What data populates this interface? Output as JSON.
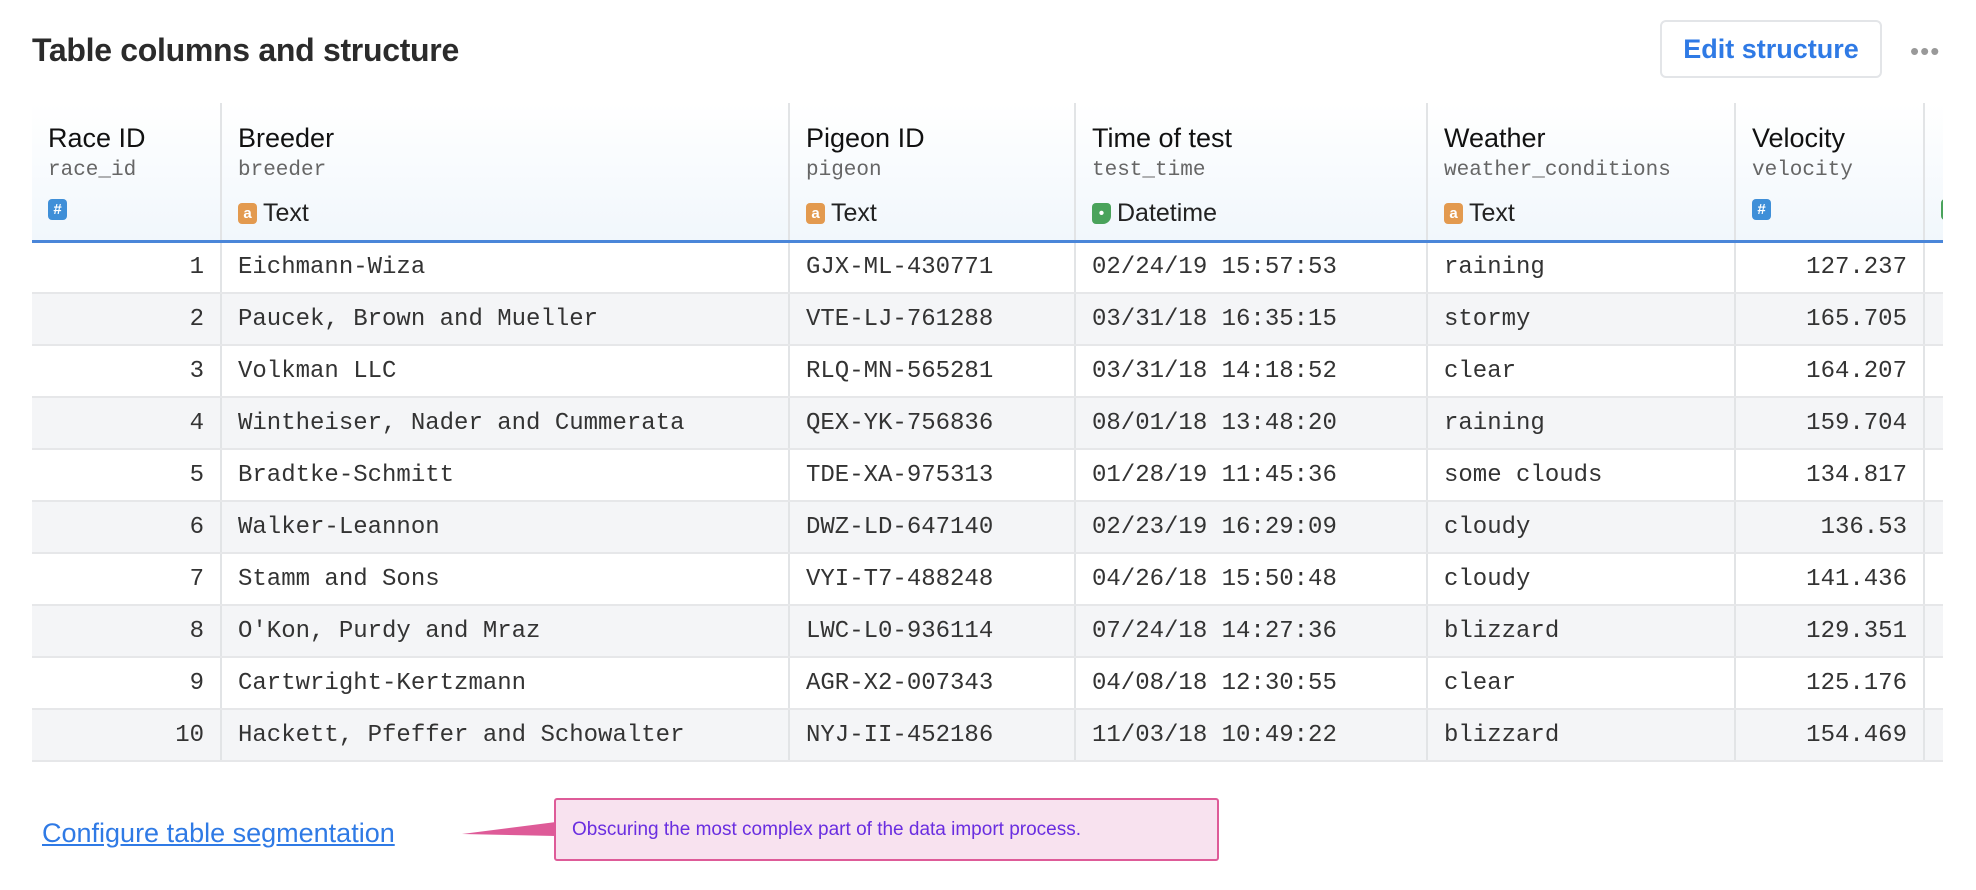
{
  "header": {
    "title": "Table columns and structure",
    "edit_button": "Edit structure",
    "more_icon": "more-horizontal-icon"
  },
  "columns": [
    {
      "name": "Race ID",
      "key": "race_id",
      "type": "",
      "type_icon": "number-icon"
    },
    {
      "name": "Breeder",
      "key": "breeder",
      "type": "Text",
      "type_icon": "text-icon"
    },
    {
      "name": "Pigeon ID",
      "key": "pigeon",
      "type": "Text",
      "type_icon": "text-icon"
    },
    {
      "name": "Time of test",
      "key": "test_time",
      "type": "Datetime",
      "type_icon": "datetime-icon"
    },
    {
      "name": "Weather",
      "key": "weather_conditions",
      "type": "Text",
      "type_icon": "text-icon"
    },
    {
      "name": "Velocity",
      "key": "velocity",
      "type": "",
      "type_icon": "number-icon"
    }
  ],
  "rows": [
    [
      "1",
      "Eichmann-Wiza",
      "GJX-ML-430771",
      "02/24/19 15:57:53",
      "raining",
      "127.237"
    ],
    [
      "2",
      "Paucek, Brown and Mueller",
      "VTE-LJ-761288",
      "03/31/18 16:35:15",
      "stormy",
      "165.705"
    ],
    [
      "3",
      "Volkman LLC",
      "RLQ-MN-565281",
      "03/31/18 14:18:52",
      "clear",
      "164.207"
    ],
    [
      "4",
      "Wintheiser, Nader and Cummerata",
      "QEX-YK-756836",
      "08/01/18 13:48:20",
      "raining",
      "159.704"
    ],
    [
      "5",
      "Bradtke-Schmitt",
      "TDE-XA-975313",
      "01/28/19 11:45:36",
      "some clouds",
      "134.817"
    ],
    [
      "6",
      "Walker-Leannon",
      "DWZ-LD-647140",
      "02/23/19 16:29:09",
      "cloudy",
      "136.53"
    ],
    [
      "7",
      "Stamm and Sons",
      "VYI-T7-488248",
      "04/26/18 15:50:48",
      "cloudy",
      "141.436"
    ],
    [
      "8",
      "O'Kon, Purdy and Mraz",
      "LWC-L0-936114",
      "07/24/18 14:27:36",
      "blizzard",
      "129.351"
    ],
    [
      "9",
      "Cartwright-Kertzmann",
      "AGR-X2-007343",
      "04/08/18 12:30:55",
      "clear",
      "125.176"
    ],
    [
      "10",
      "Hackett, Pfeffer and Schowalter",
      "NYJ-II-452186",
      "11/03/18 10:49:22",
      "blizzard",
      "154.469"
    ]
  ],
  "footer": {
    "link": "Configure table segmentation",
    "annotation": "Obscuring the most complex part of the data import process."
  },
  "colors": {
    "accent": "#2f7ae5",
    "annotation_border": "#de5b98",
    "annotation_bg": "#f8e2ef",
    "annotation_text": "#6a2ee0"
  }
}
